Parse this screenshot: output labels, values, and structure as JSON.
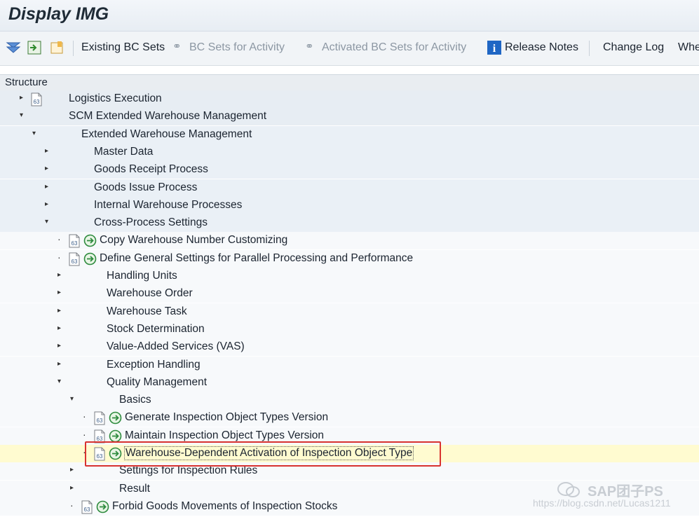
{
  "window": {
    "title": "Display IMG"
  },
  "toolbar": {
    "buttons": [
      {
        "label": "Existing BC Sets",
        "enabled": true
      },
      {
        "label": "BC Sets for Activity",
        "enabled": false
      },
      {
        "label": "Activated BC Sets for Activity",
        "enabled": false
      },
      {
        "label": "Release Notes",
        "enabled": true
      },
      {
        "label": "Change Log",
        "enabled": true
      },
      {
        "label": "Whe",
        "enabled": true
      }
    ],
    "icons": [
      "filter-icon",
      "expand-subtree-icon",
      "bookmark-icon",
      "info-icon"
    ]
  },
  "structure": {
    "header": "Structure"
  },
  "tree": [
    {
      "label": "Logistics Execution",
      "level": 0,
      "state": "collapsed",
      "has_doc": true,
      "has_activity": false
    },
    {
      "label": "SCM Extended Warehouse Management",
      "level": 0,
      "state": "expanded",
      "has_doc": false,
      "has_activity": false
    },
    {
      "label": "Extended Warehouse Management",
      "level": 1,
      "state": "expanded",
      "has_doc": false,
      "has_activity": false
    },
    {
      "label": "Master Data",
      "level": 2,
      "state": "collapsed",
      "has_doc": false,
      "has_activity": false
    },
    {
      "label": "Goods Receipt Process",
      "level": 2,
      "state": "collapsed",
      "has_doc": false,
      "has_activity": false
    },
    {
      "label": "Goods Issue Process",
      "level": 2,
      "state": "collapsed",
      "has_doc": false,
      "has_activity": false
    },
    {
      "label": "Internal Warehouse Processes",
      "level": 2,
      "state": "collapsed",
      "has_doc": false,
      "has_activity": false
    },
    {
      "label": "Cross-Process Settings",
      "level": 2,
      "state": "expanded",
      "has_doc": false,
      "has_activity": false
    },
    {
      "label": "Copy Warehouse Number Customizing",
      "level": 3,
      "state": "leaf",
      "has_doc": true,
      "has_activity": true
    },
    {
      "label": "Define General Settings for Parallel Processing and Performance",
      "level": 3,
      "state": "leaf",
      "has_doc": true,
      "has_activity": true
    },
    {
      "label": "Handling Units",
      "level": 3,
      "state": "collapsed",
      "has_doc": false,
      "has_activity": false
    },
    {
      "label": "Warehouse Order",
      "level": 3,
      "state": "collapsed",
      "has_doc": false,
      "has_activity": false
    },
    {
      "label": "Warehouse Task",
      "level": 3,
      "state": "collapsed",
      "has_doc": false,
      "has_activity": false
    },
    {
      "label": "Stock Determination",
      "level": 3,
      "state": "collapsed",
      "has_doc": false,
      "has_activity": false
    },
    {
      "label": "Value-Added Services (VAS)",
      "level": 3,
      "state": "collapsed",
      "has_doc": false,
      "has_activity": false
    },
    {
      "label": "Exception Handling",
      "level": 3,
      "state": "collapsed",
      "has_doc": false,
      "has_activity": false
    },
    {
      "label": "Quality Management",
      "level": 3,
      "state": "expanded",
      "has_doc": false,
      "has_activity": false
    },
    {
      "label": "Basics",
      "level": 4,
      "state": "expanded",
      "has_doc": false,
      "has_activity": false
    },
    {
      "label": "Generate Inspection Object Types Version",
      "level": 5,
      "state": "leaf",
      "has_doc": true,
      "has_activity": true
    },
    {
      "label": "Maintain Inspection Object Types Version",
      "level": 5,
      "state": "leaf",
      "has_doc": true,
      "has_activity": true
    },
    {
      "label": "Warehouse-Dependent Activation of Inspection Object Type",
      "level": 5,
      "state": "leaf",
      "has_doc": true,
      "has_activity": true,
      "selected": true
    },
    {
      "label": "Settings for Inspection Rules",
      "level": 4,
      "state": "collapsed",
      "has_doc": false,
      "has_activity": false
    },
    {
      "label": "Result",
      "level": 4,
      "state": "collapsed",
      "has_doc": false,
      "has_activity": false
    },
    {
      "label": "Forbid Goods Movements of Inspection Stocks",
      "level": 4,
      "state": "leaf",
      "has_doc": true,
      "has_activity": true
    }
  ],
  "watermark": {
    "brand": "SAP团子PS",
    "url": "https://blog.csdn.net/Lucas1211"
  },
  "colors": {
    "highlight": "#fffbd0",
    "highlight_border": "#d8322f",
    "activity_green": "#2e8b3e",
    "shade": "#eaf0f6"
  }
}
